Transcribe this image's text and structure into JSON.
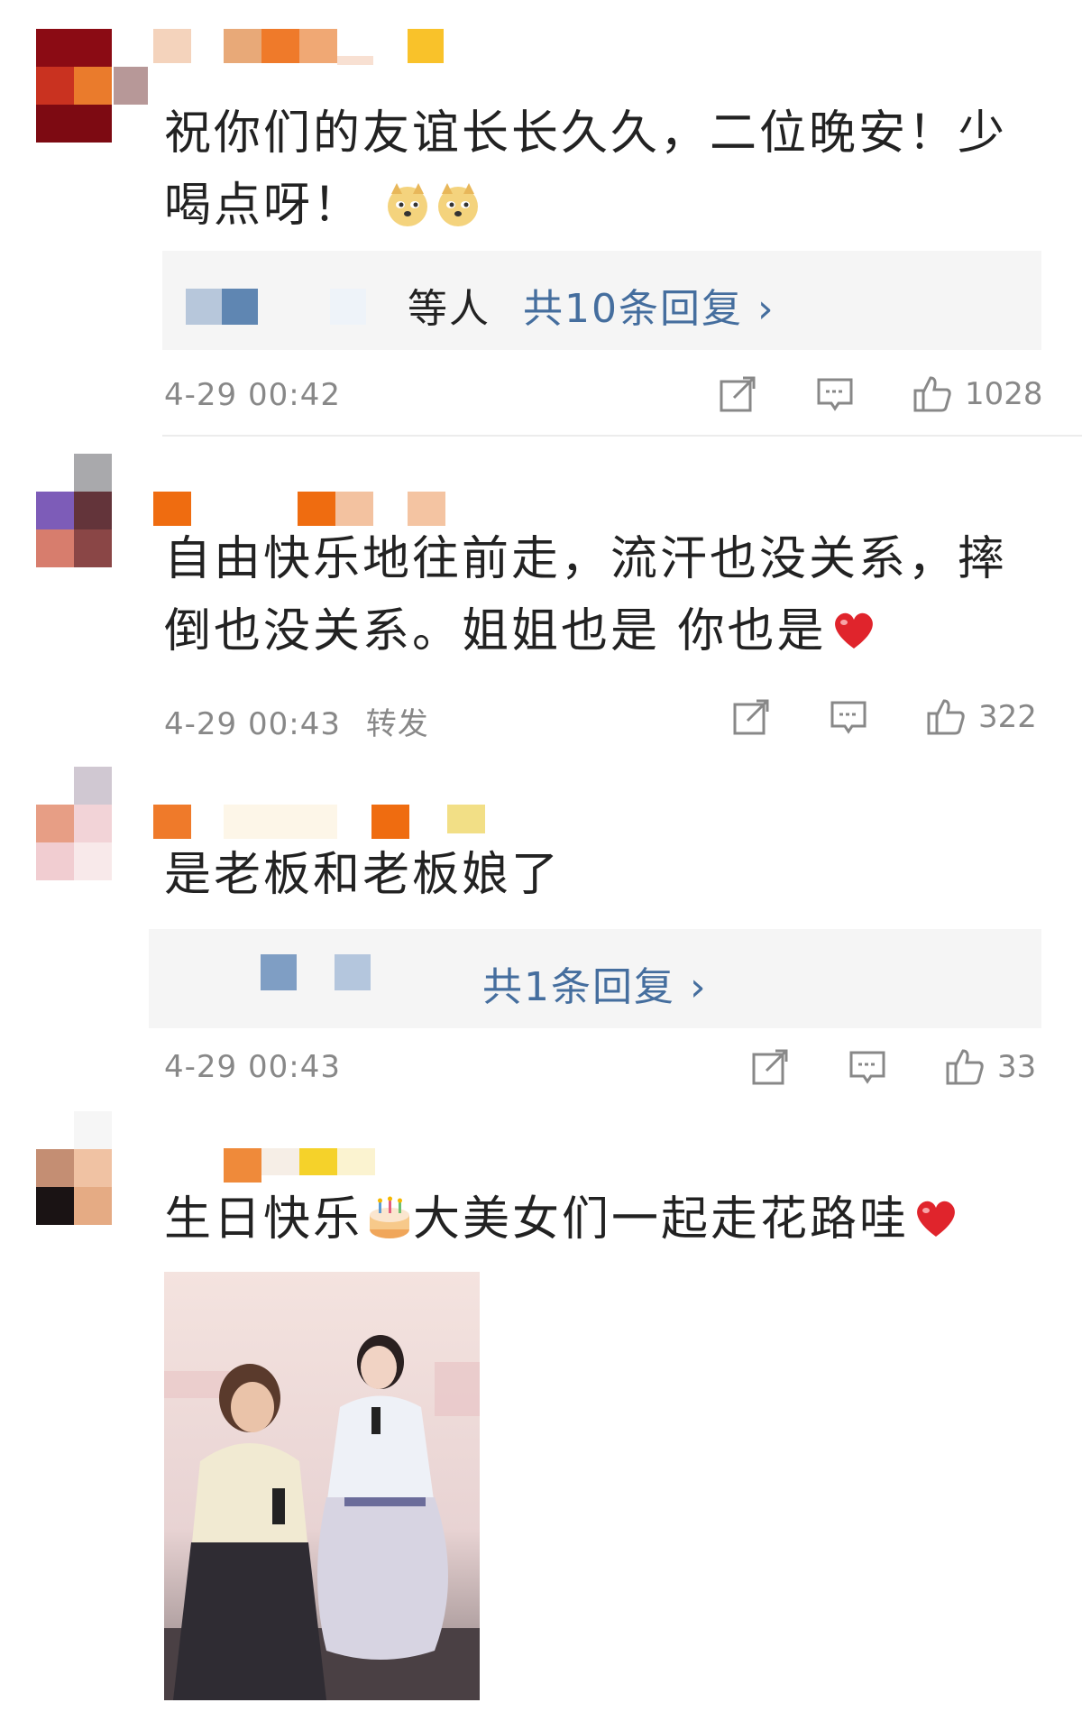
{
  "comments": [
    {
      "text": "祝你们的友谊长长久久，二位晚安！少喝点呀！",
      "emoji": [
        "doge-emoji",
        "doge-emoji"
      ],
      "reply_prefix": "等人",
      "reply_link": "共10条回复 ›",
      "timestamp": "4-29 00:42",
      "extra": "",
      "likes": "1028"
    },
    {
      "text": "自由快乐地往前走，流汗也没关系，摔倒也没关系。姐姐也是 你也是",
      "emoji": [
        "heart-emoji"
      ],
      "timestamp": "4-29 00:43",
      "extra": "转发",
      "likes": "322"
    },
    {
      "text": "是老板和老板娘了",
      "reply_link": "共1条回复 ›",
      "timestamp": "4-29 00:43",
      "extra": "",
      "likes": "33"
    },
    {
      "text_before": "生日快乐",
      "text_after": "大美女们一起走花路哇",
      "emoji": [
        "cake-emoji",
        "heart-emoji"
      ]
    }
  ],
  "icons": {
    "share": "share-icon",
    "comment": "comment-icon",
    "like": "thumbs-up-icon"
  },
  "colors": {
    "link": "#456e9e",
    "meta": "#888888",
    "reply_bg": "#f5f5f5"
  }
}
